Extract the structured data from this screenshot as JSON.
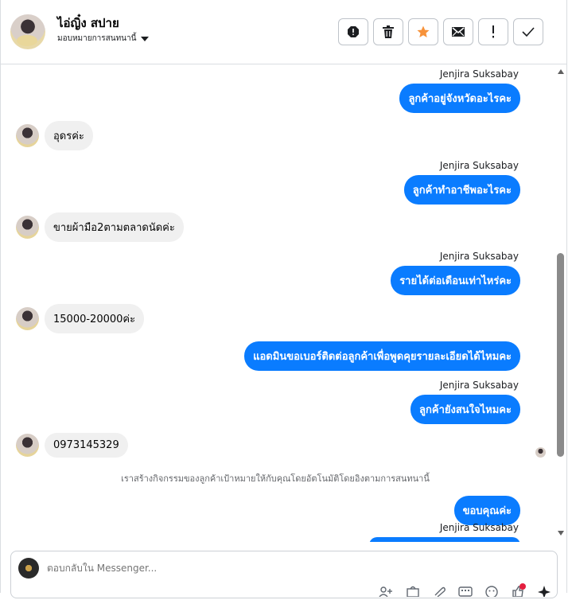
{
  "header": {
    "name": "ไอ่ญิ๋ง สปาย",
    "assign_label": "มอบหมายการสนทนานี้",
    "actions": [
      {
        "name": "spam-icon"
      },
      {
        "name": "trash-icon"
      },
      {
        "name": "star-icon"
      },
      {
        "name": "mail-icon"
      },
      {
        "name": "exclamation-icon"
      },
      {
        "name": "check-icon"
      }
    ]
  },
  "colors": {
    "outgoing": "#0a7cff",
    "incoming": "#f0f0f0",
    "star": "#f7923a"
  },
  "messages": {
    "m1_sender": "Jenjira Suksabay",
    "m1_text": "ลูกค้าอยู่จังหวัดอะไรคะ",
    "m2_text": "อุดรค่ะ",
    "m3_sender": "Jenjira Suksabay",
    "m3_text": "ลูกค้าทำอาชีพอะไรคะ",
    "m4_text": "ขายผ้ามือ2ตามตลาดนัดค่ะ",
    "m5_sender": "Jenjira Suksabay",
    "m5_text": "รายได้ต่อเดือนเท่าไหร่คะ",
    "m6_text": "15000-20000ค่ะ",
    "m7_text": "แอดมินขอเบอร์ติดต่อลูกค้าเพื่อพูดคุยรายละเอียดได้ไหมคะ",
    "m8_sender": "Jenjira Suksabay",
    "m8_text": "ลูกค้ายังสนใจไหมคะ",
    "m9_text": "0973145329",
    "system_text": "เราสร้างกิจกรรมของลูกค้าเป้าหมายให้กับคุณโดยอัตโนมัติโดยอิงตามการสนทนานี้",
    "m10_text": "ขอบคุณค่ะ",
    "m11_sender": "Jenjira Suksabay"
  },
  "reply": {
    "placeholder": "ตอบกลับใน Messenger..."
  }
}
